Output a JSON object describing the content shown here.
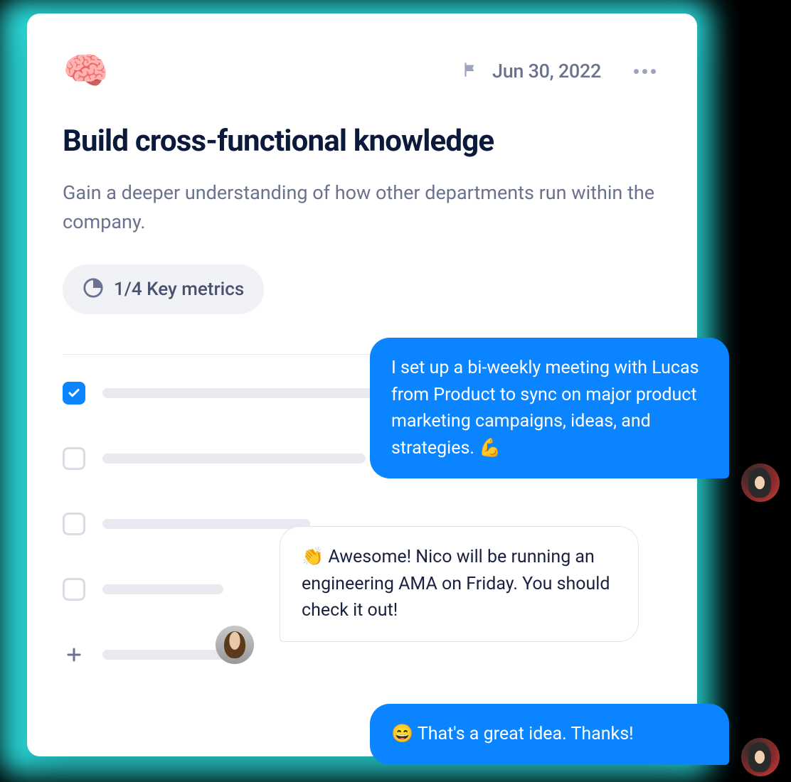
{
  "header": {
    "icon_emoji": "🧠",
    "date": "Jun 30, 2022"
  },
  "title": "Build cross-functional knowledge",
  "description": "Gain a deeper understanding of how other departments run within the company.",
  "metrics": {
    "label": "1/4 Key metrics",
    "completed": 1,
    "total": 4
  },
  "checklist": {
    "items": [
      {
        "checked": true
      },
      {
        "checked": false
      },
      {
        "checked": false
      },
      {
        "checked": false
      }
    ]
  },
  "messages": {
    "m1": "I set up a bi-weekly meeting with Lucas from Product to sync on major product marketing campaigns, ideas, and strategies. 💪",
    "m2": "👏 Awesome! Nico will be running an engineering AMA on Friday. You should check it out!",
    "m3": "😄 That's a great idea. Thanks!"
  }
}
